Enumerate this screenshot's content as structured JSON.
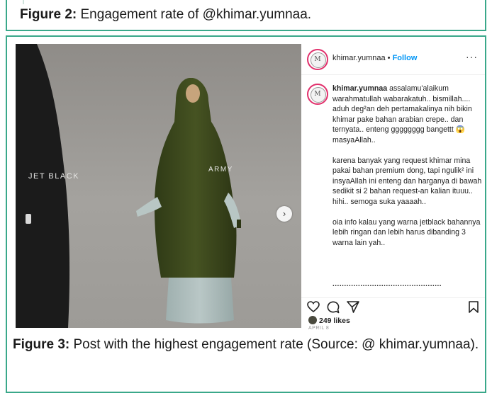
{
  "figure2": {
    "label": "Figure 2:",
    "text": " Engagement rate of @khimar.yumnaa."
  },
  "photo": {
    "label_left": "JET BLACK",
    "label_right": "ARMY",
    "next_icon": "chevron-right-icon"
  },
  "post": {
    "username": "khimar.yumnaa",
    "separator": " • ",
    "follow_label": "Follow",
    "more": "···",
    "caption_user": "khimar.yumnaa",
    "caption_p1": " assalamu'alaikum warahmatullah wabarakatuh.. bismillah.... aduh deg²an deh pertamakalinya nih bikin khimar pake bahan arabian crepe.. dan ternyata.. enteng gggggggg bangettt 😱 masyaAllah..",
    "caption_p2": "karena banyak yang request khimar mina pakai bahan premium dong, tapi ngulik² ini insyaAllah ini enteng dan harganya di bawah sedikit si 2 bahan request-an kalian ituuu.. hihi.. semoga suka yaaaah..",
    "caption_p3": "oia info kalau yang warna jetblack bahannya lebih ringan dan lebih harus dibanding 3 warna lain yah..",
    "dots": "...............................................",
    "dots_small": "......................",
    "likes": "249 likes",
    "date": "APRIL 8",
    "icons": [
      "heart-icon",
      "comment-icon",
      "share-icon",
      "bookmark-icon"
    ]
  },
  "figure3": {
    "label": "Figure 3:",
    "text": " Post with the highest engagement rate (Source: @ khimar.yumnaa)."
  },
  "colors": {
    "border": "#3aa88a",
    "follow": "#0095f6",
    "army_green": "#3f4a1f",
    "jet_black": "#1b1b1b",
    "skirt": "#a9b9b8"
  }
}
